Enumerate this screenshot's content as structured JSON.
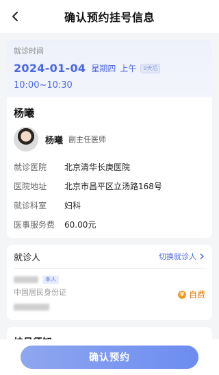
{
  "header": {
    "title": "确认预约挂号信息",
    "back_icon": "chevron-left-icon"
  },
  "appointment": {
    "time_label": "就诊时间",
    "date": "2024-01-04",
    "weekday": "星期四",
    "period": "上午",
    "days_badge": "9天后",
    "time_range": "10:00~10:30"
  },
  "patient_name": "杨曦",
  "doctor": {
    "name": "杨曦",
    "title": "副主任医师",
    "avatar_icon": "doctor-avatar"
  },
  "info": [
    {
      "key": "就诊医院",
      "value": "北京清华长庚医院"
    },
    {
      "key": "医院地址",
      "value": "北京市昌平区立汤路168号"
    },
    {
      "key": "就诊科室",
      "value": "妇科"
    },
    {
      "key": "医事服务费",
      "value": "60.00元"
    }
  ],
  "visitor": {
    "section_title": "就诊人",
    "switch_label": "切换就诊人",
    "self_tag": "本人",
    "id_type": "中国居民身份证",
    "payment": "自费",
    "payment_icon": "yen-coin-icon"
  },
  "notice": {
    "title": "挂号须知"
  },
  "confirm_button": "确认预约",
  "colors": {
    "accent": "#4a67e8",
    "payment": "#e8780a"
  }
}
